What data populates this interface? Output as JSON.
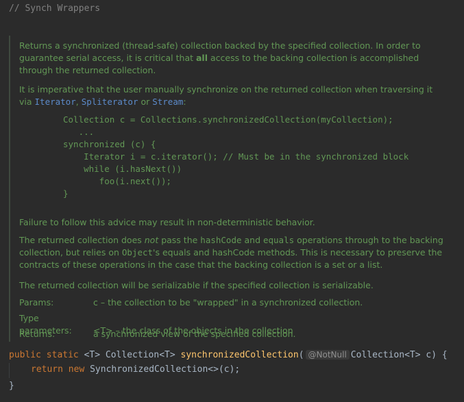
{
  "header_comment": "// Synch Wrappers",
  "doc": {
    "p1_a": "Returns a synchronized (thread-safe) collection backed by the specified collection. In order to guarantee serial access, it is critical that ",
    "p1_bold": "all",
    "p1_b": " access to the backing collection is accomplished through the returned collection.",
    "p2_a": "It is imperative that the user manually synchronize on the returned collection when traversing it via ",
    "link_iterator": "Iterator",
    "p2_comma": ", ",
    "link_spliterator": "Spliterator",
    "p2_or": " or ",
    "link_stream": "Stream",
    "p2_colon": ":",
    "code_lines": [
      "Collection c = Collections.synchronizedCollection(myCollection);",
      "   ...",
      "synchronized (c) {",
      "    Iterator i = c.iterator(); // Must be in the synchronized block",
      "    while (i.hasNext())",
      "       foo(i.next());",
      "}"
    ],
    "p3": "Failure to follow this advice may result in non-deterministic behavior.",
    "p4_a": "The returned collection does ",
    "p4_not": "not",
    "p4_b": " pass the ",
    "p4_hashcode": "hashCode",
    "p4_c": " and ",
    "p4_equals": "equals",
    "p4_d": " operations through to the backing collection, but relies on ",
    "p4_object": "Object",
    "p4_e": "'s equals and hashCode methods. This is necessary to preserve the contracts of these operations in the case that the backing collection is a set or a list.",
    "p5": "The returned collection will be serializable if the specified collection is serializable.",
    "params_label": "Params:",
    "params_value": "c – the collection to be \"wrapped\" in a synchronized collection.",
    "typeparams_label": "Type parameters:",
    "typeparams_value": "<T> – the class of the objects in the collection",
    "returns_label": "Returns:",
    "returns_value": "a synchronized view of the specified collection."
  },
  "signature": {
    "kw_public": "public",
    "kw_static": "static",
    "type_param": "<T>",
    "return_type": "Collection",
    "return_type_param": "<T>",
    "method_name": "synchronizedCollection",
    "open_paren": "(",
    "annotation": "@NotNull",
    "param_type": "Collection",
    "param_type_param": "<T>",
    "param_rest": " c) {"
  },
  "body": {
    "kw_return": "return",
    "kw_new": "new",
    "expr": "SynchronizedCollection<>(c);",
    "close_brace": "}"
  },
  "colors": {
    "background": "#2b2b2b",
    "doc_text": "#629755",
    "keyword": "#cc7832",
    "method": "#ffc66d",
    "link": "#5c8bcb"
  }
}
